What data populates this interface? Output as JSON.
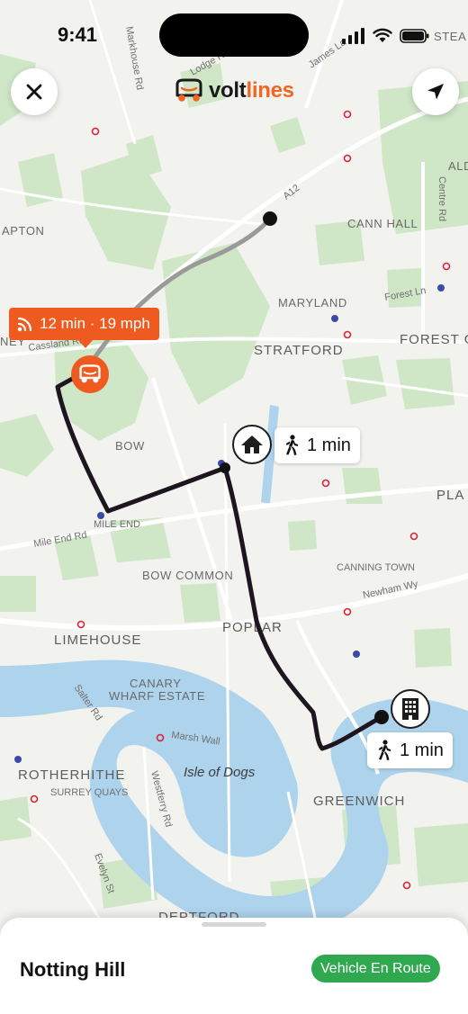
{
  "status_bar": {
    "time": "9:41",
    "icons": [
      "cellular-signal-icon",
      "wifi-icon",
      "battery-icon"
    ]
  },
  "header": {
    "logo_part1": "volt",
    "logo_part2": "lines",
    "close_icon": "close-icon",
    "locate_icon": "location-arrow-icon"
  },
  "map": {
    "area_labels": [
      "CANN HALL",
      "MARYLAND",
      "STRATFORD",
      "FOREST G",
      "BOW",
      "PLA",
      "BOW COMMON",
      "CANNING TOWN",
      "POPLAR",
      "LIMEHOUSE",
      "CANARY",
      "WHARF ESTATE",
      "ROTHERHITHE",
      "SURREY QUAYS",
      "GREENWICH",
      "DEPTFORD",
      "APTON",
      "ALD",
      "NEY",
      "STEA"
    ],
    "road_labels": [
      "A12",
      "Markhouse Rd",
      "Forest Ln",
      "Cassland Rd",
      "Mile End Rd",
      "MILE END",
      "Newham Wy",
      "Marsh Wall",
      "Salter Rd",
      "Westferry Rd",
      "Evelyn St",
      "Centre Rd",
      "James La",
      "Lodge Rd"
    ],
    "island_label": "Isle of Dogs"
  },
  "vehicle": {
    "eta_text": "12 min · 19 mph",
    "signal_icon": "live-signal-icon",
    "marker_icon": "vehicle-icon"
  },
  "stops": {
    "pickup_icon": "home-icon",
    "pickup_walk": "1 min",
    "dropoff_icon": "office-building-icon",
    "dropoff_walk": "1 min",
    "walk_icon": "walking-person-icon"
  },
  "sheet": {
    "destination": "Notting Hill",
    "status": "Vehicle En Route"
  },
  "colors": {
    "brand_orange": "#ee5a1f",
    "status_green": "#2fa84f",
    "route": "#1d1520",
    "traveled_route": "#9a9a9a",
    "water": "#aed3ec",
    "park": "#cfe7c7"
  }
}
